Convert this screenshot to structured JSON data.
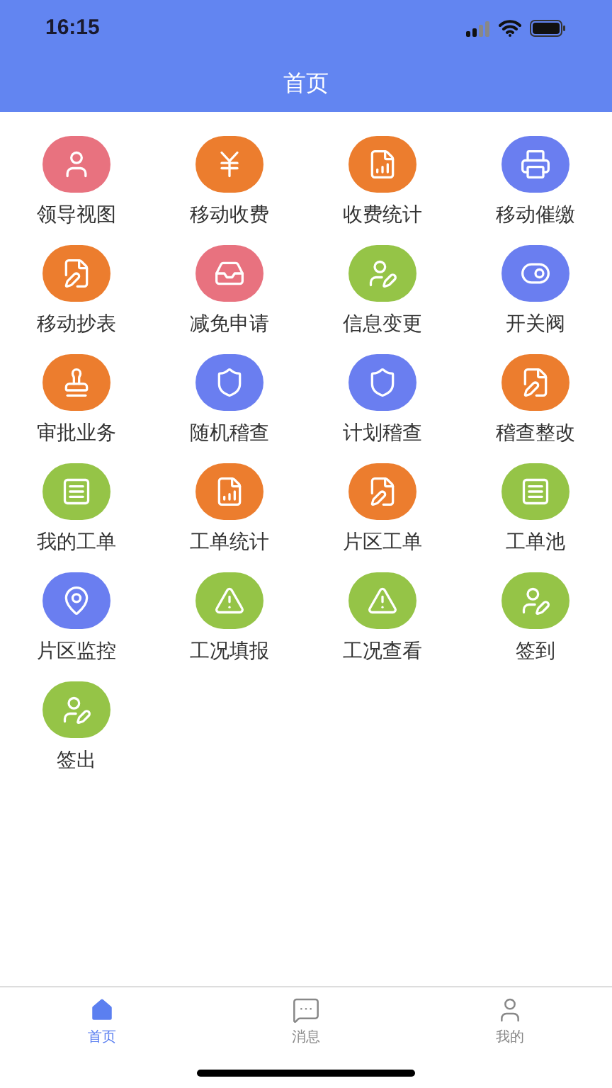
{
  "status_bar": {
    "time": "16:15"
  },
  "header": {
    "title": "首页"
  },
  "apps": [
    {
      "label": "领导视图",
      "kind": "person",
      "color": "#e8727f"
    },
    {
      "label": "移动收费",
      "kind": "yen",
      "color": "#ec7d2e"
    },
    {
      "label": "收费统计",
      "kind": "chart",
      "color": "#ec7d2e"
    },
    {
      "label": "移动催缴",
      "kind": "printer",
      "color": "#6a7ef0"
    },
    {
      "label": "移动抄表",
      "kind": "edit",
      "color": "#ec7d2e"
    },
    {
      "label": "减免申请",
      "kind": "tray",
      "color": "#e8727f"
    },
    {
      "label": "信息变更",
      "kind": "user-edit",
      "color": "#95c447"
    },
    {
      "label": "开关阀",
      "kind": "toggle",
      "color": "#6a7ef0"
    },
    {
      "label": "审批业务",
      "kind": "stamp",
      "color": "#ec7d2e"
    },
    {
      "label": "随机稽查",
      "kind": "shield",
      "color": "#6a7ef0"
    },
    {
      "label": "计划稽查",
      "kind": "shield",
      "color": "#6a7ef0"
    },
    {
      "label": "稽查整改",
      "kind": "edit",
      "color": "#ec7d2e"
    },
    {
      "label": "我的工单",
      "kind": "list",
      "color": "#95c447"
    },
    {
      "label": "工单统计",
      "kind": "chart",
      "color": "#ec7d2e"
    },
    {
      "label": "片区工单",
      "kind": "edit",
      "color": "#ec7d2e"
    },
    {
      "label": "工单池",
      "kind": "list",
      "color": "#95c447"
    },
    {
      "label": "片区监控",
      "kind": "pin",
      "color": "#6a7ef0"
    },
    {
      "label": "工况填报",
      "kind": "warning",
      "color": "#95c447"
    },
    {
      "label": "工况查看",
      "kind": "warning",
      "color": "#95c447"
    },
    {
      "label": "签到",
      "kind": "user-edit",
      "color": "#95c447"
    },
    {
      "label": "签出",
      "kind": "user-edit",
      "color": "#95c447"
    }
  ],
  "tabs": [
    {
      "label": "首页",
      "kind": "home",
      "selected": true
    },
    {
      "label": "消息",
      "kind": "message",
      "selected": false
    },
    {
      "label": "我的",
      "kind": "profile",
      "selected": false
    }
  ]
}
